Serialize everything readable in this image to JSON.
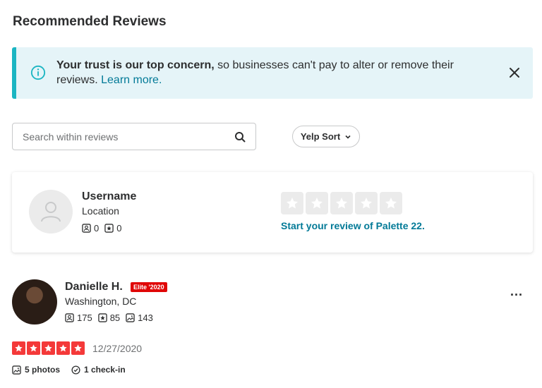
{
  "section_title": "Recommended Reviews",
  "trust_banner": {
    "bold_text": "Your trust is our top concern,",
    "text": " so businesses can't pay to alter or remove their reviews. ",
    "link": "Learn more.",
    "icon": "info-icon",
    "close_icon": "close-icon"
  },
  "search": {
    "placeholder": "Search within reviews",
    "icon": "search-icon"
  },
  "sort": {
    "label": "Yelp Sort",
    "icon": "chevron-down-icon"
  },
  "my_review": {
    "username": "Username",
    "location": "Location",
    "friends": "0",
    "reviews": "0",
    "prompt_prefix": "Start your review of ",
    "business": "Palette 22",
    "prompt_suffix": "."
  },
  "review": {
    "name": "Danielle H.",
    "elite_badge": "Elite '2020",
    "location": "Washington, DC",
    "friends": "175",
    "reviews": "85",
    "photos": "143",
    "rating": 5,
    "date": "12/27/2020",
    "photos_label": "5 photos",
    "checkin_label": "1 check-in",
    "more_label": "..."
  },
  "colors": {
    "banner_bg": "#e5f4f8",
    "banner_accent": "#1bb5c2",
    "link": "#027a97",
    "star_red": "#f43939",
    "elite_red": "#e00707"
  }
}
